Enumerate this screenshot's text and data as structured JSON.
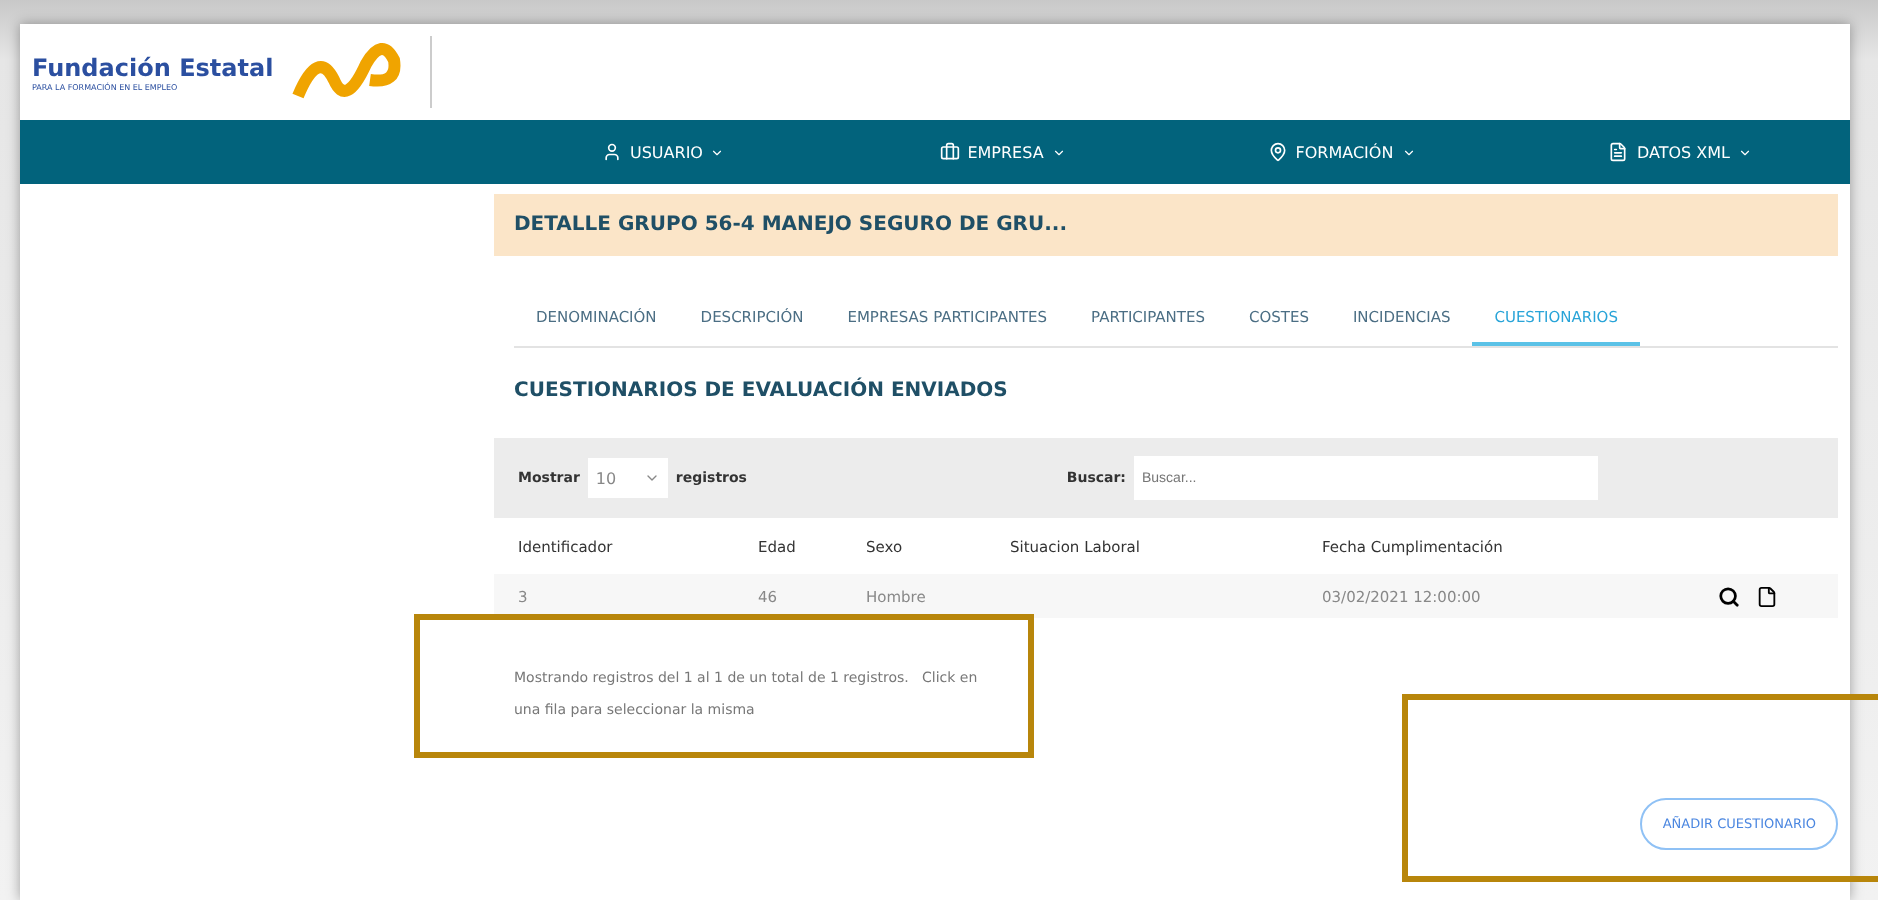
{
  "header": {
    "brand": "Fundación Estatal",
    "subtitle": "PARA LA FORMACIÓN EN EL EMPLEO"
  },
  "nav": [
    {
      "label": "USUARIO"
    },
    {
      "label": "EMPRESA"
    },
    {
      "label": "FORMACIÓN"
    },
    {
      "label": "DATOS XML"
    }
  ],
  "banner": "DETALLE GRUPO 56-4 MANEJO SEGURO DE GRU...",
  "tabs": [
    {
      "label": "DENOMINACIÓN",
      "selected": false
    },
    {
      "label": "DESCRIPCIÓN",
      "selected": false
    },
    {
      "label": "EMPRESAS PARTICIPANTES",
      "selected": false
    },
    {
      "label": "PARTICIPANTES",
      "selected": false
    },
    {
      "label": "COSTES",
      "selected": false
    },
    {
      "label": "INCIDENCIAS",
      "selected": false
    },
    {
      "label": "CUESTIONARIOS",
      "selected": true
    }
  ],
  "section_title": "CUESTIONARIOS DE EVALUACIÓN ENVIADOS",
  "toolbar": {
    "show_label": "Mostrar",
    "page_size": "10",
    "records_label": "registros",
    "search_label": "Buscar:",
    "search_placeholder": "Buscar..."
  },
  "table": {
    "columns": [
      "Identificador",
      "Edad",
      "Sexo",
      "Situacion Laboral",
      "Fecha Cumplimentación"
    ],
    "rows": [
      {
        "cells": [
          "3",
          "46",
          "Hombre",
          null,
          "03/02/2021 12:00:00"
        ]
      }
    ]
  },
  "info": "Mostrando registros del 1 al 1 de un total de 1 registros.   Click en una fila para seleccionar la misma",
  "add_button": "AÑADIR CUESTIONARIO"
}
